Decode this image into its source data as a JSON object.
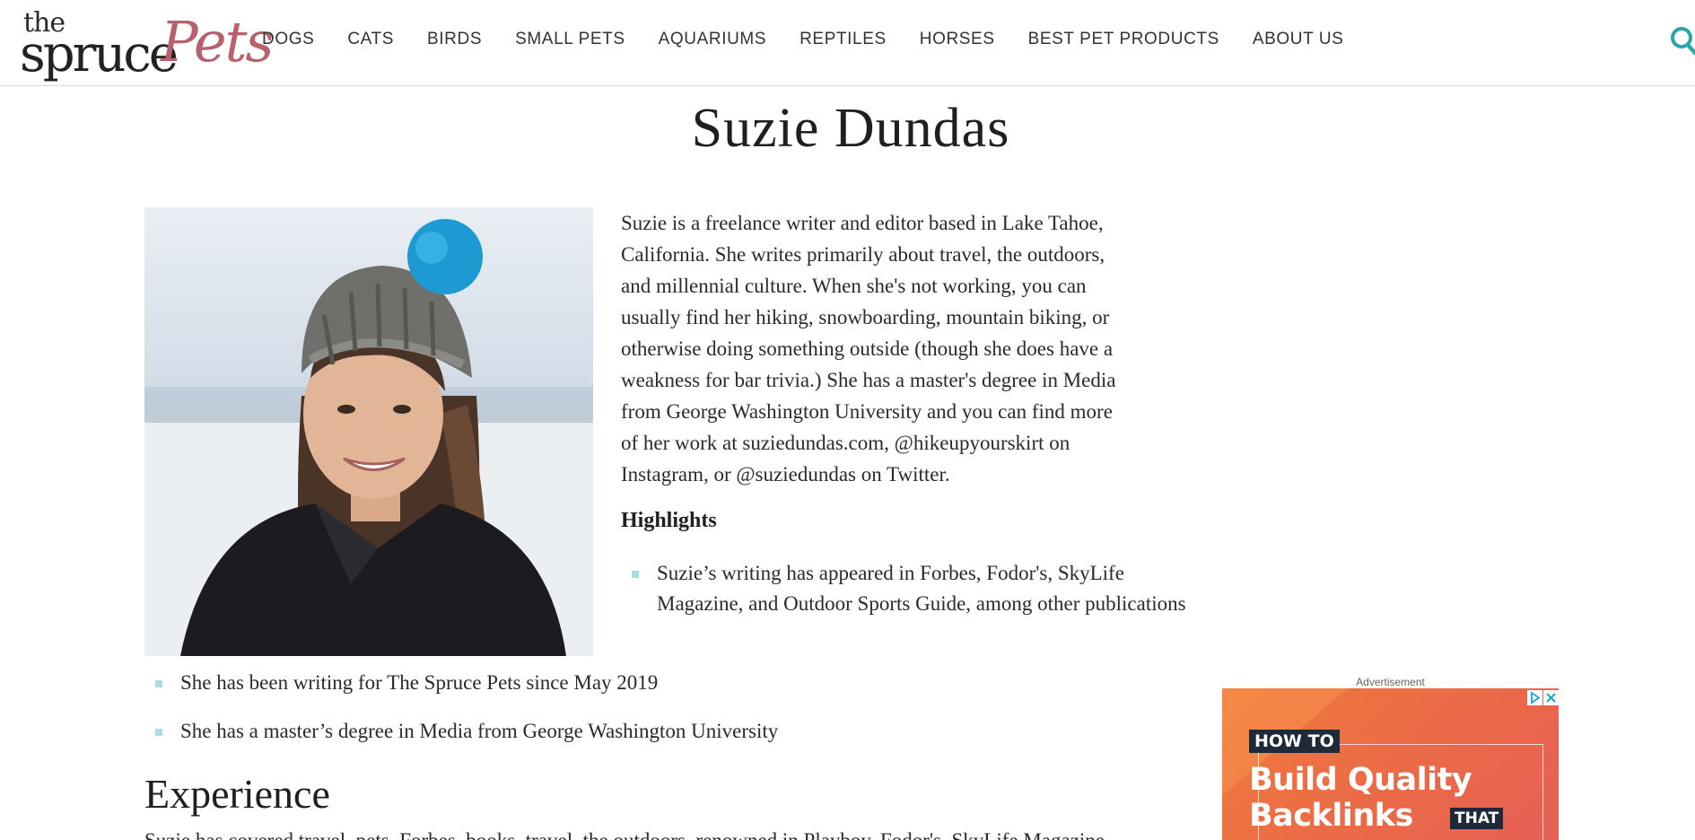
{
  "header": {
    "logo": {
      "the": "the",
      "spruce": "spruce",
      "pets": "Pets"
    },
    "nav": [
      "DOGS",
      "CATS",
      "BIRDS",
      "SMALL PETS",
      "AQUARIUMS",
      "REPTILES",
      "HORSES",
      "BEST PET PRODUCTS",
      "ABOUT US"
    ],
    "search_icon": "search-icon",
    "accent_color": "#2aa6a8"
  },
  "main": {
    "title": "Suzie Dundas",
    "bio_lines": [
      "Suzie is a freelance writer and editor based in Lake Tahoe,",
      "California. She writes primarily about travel, the outdoors,",
      "and millennial culture. When she's not working, you can",
      "usually find her hiking, snowboarding, mountain biking, or",
      "otherwise doing something outside (though she does have a",
      "weakness for bar trivia.) She has a master's degree in Media",
      "from George Washington University and you can find more",
      "of her work at suziedundas.com, @hikeupyourskirt on",
      "Instagram, or @suziedundas on Twitter."
    ],
    "highlights_heading": "Highlights",
    "highlights": [
      "Suzie’s writing has appeared in Forbes, Fodor's, SkyLife Magazine, and Outdoor Sports Guide, among other publications",
      "She has been writing for The Spruce Pets since May 2019",
      "She has a master’s degree in Media from George Washington University"
    ],
    "experience_heading": "Experience",
    "experience_text": "Suzie has covered travel, pets, Forbes, books, travel, the outdoors, renowned in Playboy, Fodor's, SkyLife Magazine"
  },
  "ad": {
    "label": "Advertisement",
    "badge": "HOW TO",
    "line1": "Build Quality",
    "line2": "Backlinks",
    "tag": "THAT",
    "adchoices_icon": "adchoices-icon",
    "close_icon": "close-icon"
  }
}
